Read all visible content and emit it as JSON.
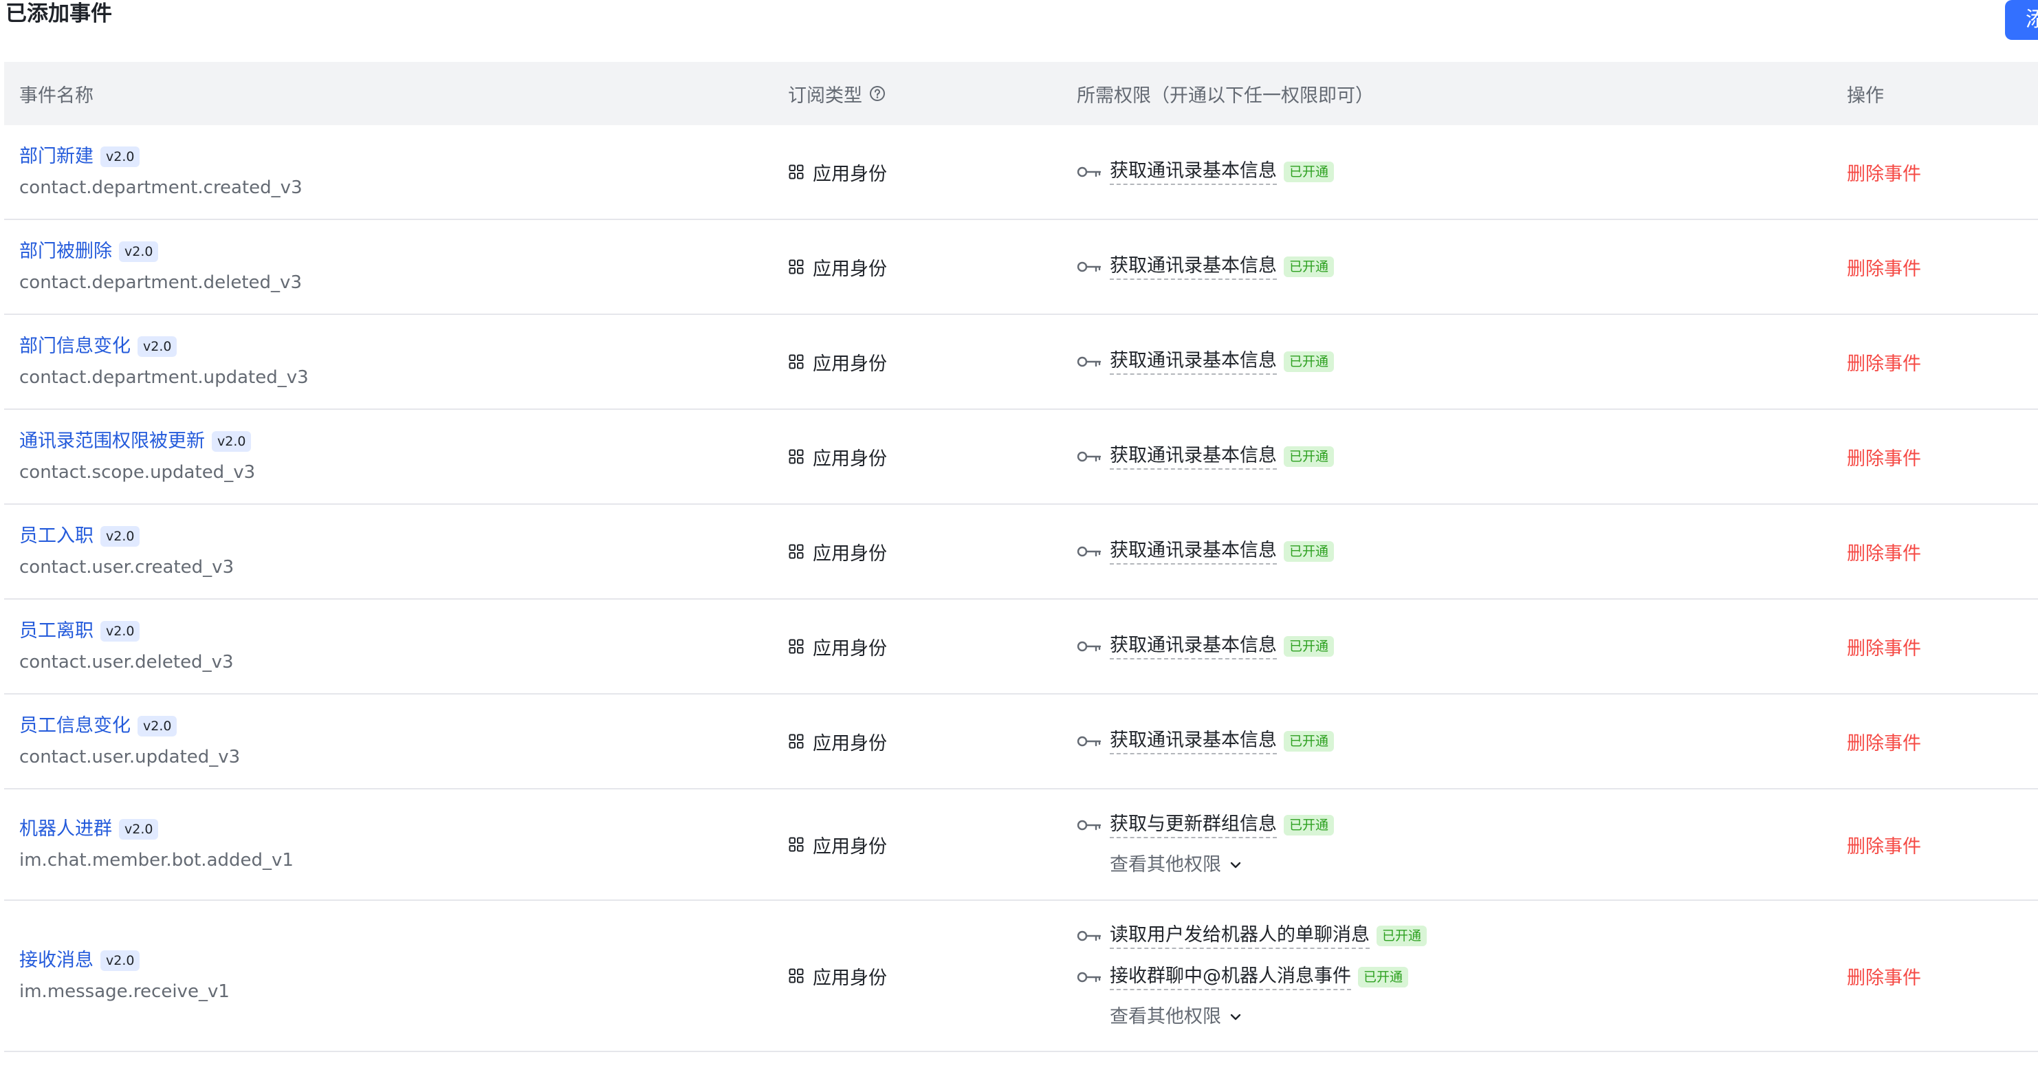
{
  "page": {
    "title": "已添加事件",
    "add_button_label": "添加事件"
  },
  "colors": {
    "link": "#245bdb",
    "danger": "#f54a45",
    "success": "#2ea121",
    "primary": "#3370ff"
  },
  "table": {
    "headers": {
      "name": "事件名称",
      "type": "订阅类型",
      "permissions": "所需权限（开通以下任一权限即可）",
      "actions": "操作"
    },
    "icons": {
      "type_help": "question-circle-icon",
      "app_identity": "grid-icon",
      "permission": "key-icon",
      "expand": "chevron-down-icon"
    },
    "rows": [
      {
        "name": "部门新建",
        "version": "v2.0",
        "event_key": "contact.department.created_v3",
        "type": "应用身份",
        "permissions": [
          {
            "name": "获取通讯录基本信息",
            "status": "已开通"
          }
        ],
        "action": "删除事件"
      },
      {
        "name": "部门被删除",
        "version": "v2.0",
        "event_key": "contact.department.deleted_v3",
        "type": "应用身份",
        "permissions": [
          {
            "name": "获取通讯录基本信息",
            "status": "已开通"
          }
        ],
        "action": "删除事件"
      },
      {
        "name": "部门信息变化",
        "version": "v2.0",
        "event_key": "contact.department.updated_v3",
        "type": "应用身份",
        "permissions": [
          {
            "name": "获取通讯录基本信息",
            "status": "已开通"
          }
        ],
        "action": "删除事件"
      },
      {
        "name": "通讯录范围权限被更新",
        "version": "v2.0",
        "event_key": "contact.scope.updated_v3",
        "type": "应用身份",
        "permissions": [
          {
            "name": "获取通讯录基本信息",
            "status": "已开通"
          }
        ],
        "action": "删除事件"
      },
      {
        "name": "员工入职",
        "version": "v2.0",
        "event_key": "contact.user.created_v3",
        "type": "应用身份",
        "permissions": [
          {
            "name": "获取通讯录基本信息",
            "status": "已开通"
          }
        ],
        "action": "删除事件"
      },
      {
        "name": "员工离职",
        "version": "v2.0",
        "event_key": "contact.user.deleted_v3",
        "type": "应用身份",
        "permissions": [
          {
            "name": "获取通讯录基本信息",
            "status": "已开通"
          }
        ],
        "action": "删除事件"
      },
      {
        "name": "员工信息变化",
        "version": "v2.0",
        "event_key": "contact.user.updated_v3",
        "type": "应用身份",
        "permissions": [
          {
            "name": "获取通讯录基本信息",
            "status": "已开通"
          }
        ],
        "action": "删除事件"
      },
      {
        "name": "机器人进群",
        "version": "v2.0",
        "event_key": "im.chat.member.bot.added_v1",
        "type": "应用身份",
        "permissions": [
          {
            "name": "获取与更新群组信息",
            "status": "已开通"
          }
        ],
        "more": "查看其他权限",
        "action": "删除事件"
      },
      {
        "name": "接收消息",
        "version": "v2.0",
        "event_key": "im.message.receive_v1",
        "type": "应用身份",
        "permissions": [
          {
            "name": "读取用户发给机器人的单聊消息",
            "status": "已开通"
          },
          {
            "name": "接收群聊中@机器人消息事件",
            "status": "已开通"
          }
        ],
        "more": "查看其他权限",
        "action": "删除事件"
      }
    ]
  }
}
